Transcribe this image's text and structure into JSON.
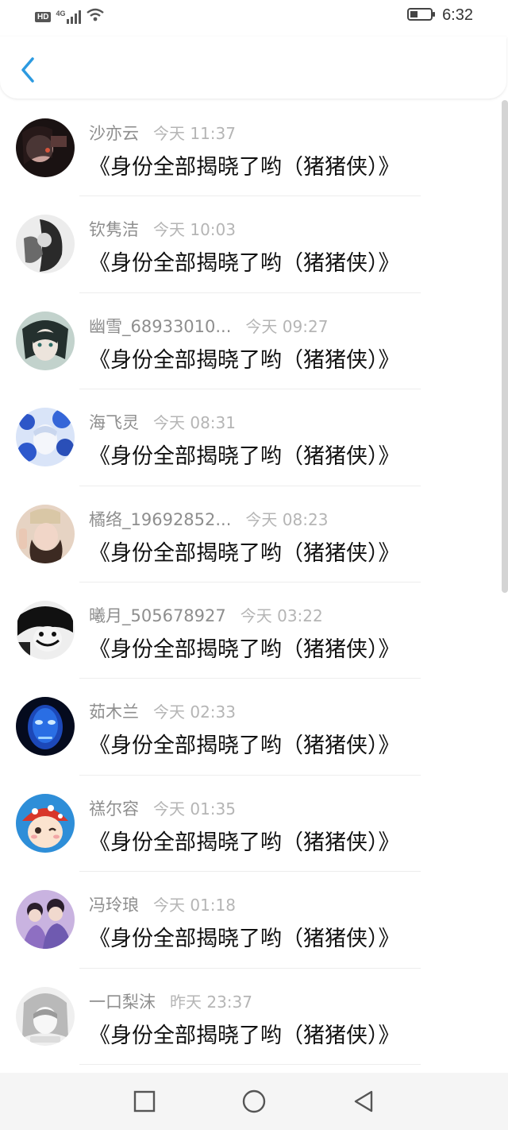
{
  "status_bar": {
    "network_badge": "HD",
    "signal_label": "4G",
    "time": "6:32"
  },
  "header": {
    "back_icon": "chevron-left-icon"
  },
  "colors": {
    "accent": "#2c9ae0",
    "username": "#8e8e8e",
    "timestamp": "#b5b5b5",
    "message": "#111111"
  },
  "messages": [
    {
      "username": "沙亦云",
      "time": "今天 11:37",
      "text": "《身份全部揭晓了哟（猪猪侠）》"
    },
    {
      "username": "钦隽洁",
      "time": "今天 10:03",
      "text": "《身份全部揭晓了哟（猪猪侠）》"
    },
    {
      "username": "幽雪_68933010...",
      "time": "今天 09:27",
      "text": "《身份全部揭晓了哟（猪猪侠）》"
    },
    {
      "username": "海飞灵",
      "time": "今天 08:31",
      "text": "《身份全部揭晓了哟（猪猪侠）》"
    },
    {
      "username": "橘络_19692852...",
      "time": "今天 08:23",
      "text": "《身份全部揭晓了哟（猪猪侠）》"
    },
    {
      "username": "曦月_505678927",
      "time": "今天 03:22",
      "text": "《身份全部揭晓了哟（猪猪侠）》"
    },
    {
      "username": "茹木兰",
      "time": "今天 02:33",
      "text": "《身份全部揭晓了哟（猪猪侠）》"
    },
    {
      "username": "禚尔容",
      "time": "今天 01:35",
      "text": "《身份全部揭晓了哟（猪猪侠）》"
    },
    {
      "username": "冯玲琅",
      "time": "今天 01:18",
      "text": "《身份全部揭晓了哟（猪猪侠）》"
    },
    {
      "username": "一口梨沫",
      "time": "昨天 23:37",
      "text": "《身份全部揭晓了哟（猪猪侠）》"
    }
  ],
  "nav_bar": {
    "recent_icon": "square-icon",
    "home_icon": "circle-icon",
    "back_icon": "triangle-back-icon"
  }
}
